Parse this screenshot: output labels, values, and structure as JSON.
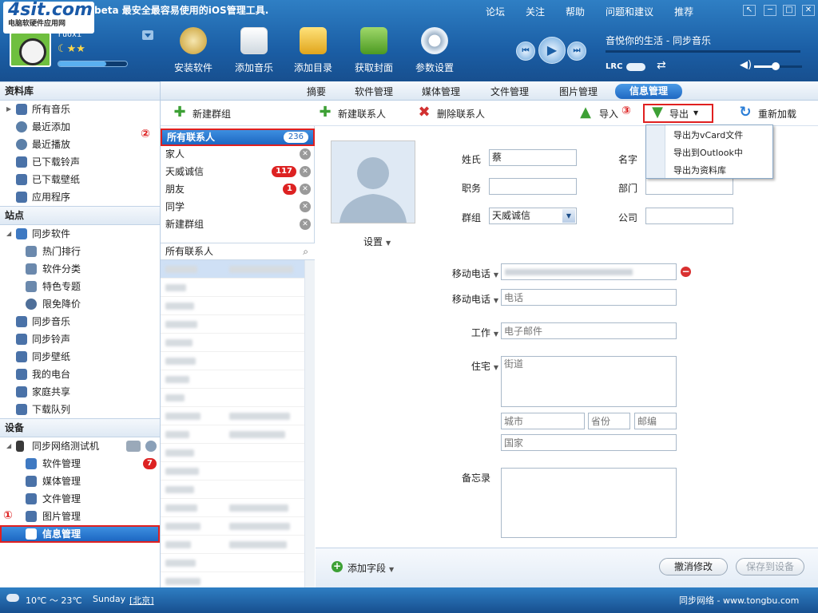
{
  "logo": {
    "text": "4sit.com",
    "subtitle": "电脑软硬件应用网"
  },
  "app": {
    "title": "beta  最安全最容易使用的iOS管理工具."
  },
  "user": {
    "name": "ruoxi",
    "level": "☾★★",
    "progress": 0.7
  },
  "toolbar_top": [
    {
      "label": "安装软件",
      "icon": "install-icon"
    },
    {
      "label": "添加音乐",
      "icon": "add-music-icon"
    },
    {
      "label": "添加目录",
      "icon": "add-folder-icon"
    },
    {
      "label": "获取封面",
      "icon": "cover-icon"
    },
    {
      "label": "参数设置",
      "icon": "gear-icon"
    }
  ],
  "top_links": [
    "论坛",
    "关注",
    "帮助",
    "问题和建议",
    "推荐"
  ],
  "player": {
    "now_playing": "音悦你的生活 - 同步音乐",
    "lrc": "LRC",
    "lrc_on": true,
    "volume": 0.4
  },
  "sidebar": {
    "library_title": "资料库",
    "library": [
      "所有音乐",
      "最近添加",
      "最近播放",
      "已下载铃声",
      "已下载壁纸",
      "应用程序"
    ],
    "site_title": "站点",
    "site": [
      "同步软件",
      "热门排行",
      "软件分类",
      "特色专题",
      "限免降价",
      "同步音乐",
      "同步铃声",
      "同步壁纸",
      "我的电台",
      "家庭共享",
      "下载队列"
    ],
    "device_title": "设备",
    "device_name": "同步网络测试机",
    "device_items": [
      "软件管理",
      "媒体管理",
      "文件管理",
      "图片管理",
      "信息管理"
    ],
    "software_badge": "7",
    "marker_1": "①"
  },
  "tabs": [
    "摘要",
    "软件管理",
    "媒体管理",
    "文件管理",
    "图片管理",
    "信息管理"
  ],
  "actions": {
    "new_group": "新建群组",
    "new_contact": "新建联系人",
    "delete_contact": "删除联系人",
    "import": "导入",
    "export": "导出",
    "reload": "重新加载",
    "marker_3": "③"
  },
  "export_menu": [
    "导出为vCard文件",
    "导出到Outlook中",
    "导出为资料库"
  ],
  "groups": {
    "all": "所有联系人",
    "all_count": "236",
    "marker_2": "②",
    "items": [
      {
        "name": "家人",
        "badge": ""
      },
      {
        "name": "天威诚信",
        "badge": "117"
      },
      {
        "name": "朋友",
        "badge": "1"
      },
      {
        "name": "同学",
        "badge": ""
      },
      {
        "name": "新建群组",
        "badge": ""
      }
    ]
  },
  "contact_list": {
    "header": "所有联系人"
  },
  "detail": {
    "photo_settings": "设置",
    "surname_label": "姓氏",
    "surname_value": "蔡",
    "firstname_label": "名字",
    "title_label": "职务",
    "dept_label": "部门",
    "group_label": "群组",
    "group_value": "天威诚信",
    "company_label": "公司",
    "mobile1_label": "移动电话",
    "mobile2_label": "移动电话",
    "mobile2_placeholder": "电话",
    "work_label": "工作",
    "work_placeholder": "电子邮件",
    "home_label": "住宅",
    "street_placeholder": "街道",
    "city_placeholder": "城市",
    "province_placeholder": "省份",
    "zip_placeholder": "邮编",
    "country_placeholder": "国家",
    "notes_label": "备忘录"
  },
  "bottom": {
    "add_field": "添加字段",
    "cancel": "撤消修改",
    "save": "保存到设备"
  },
  "status": {
    "weather": "10℃ ～ 23℃",
    "day": "Sunday",
    "city": "[北京]",
    "brand": "同步网络 - www.tongbu.com"
  }
}
